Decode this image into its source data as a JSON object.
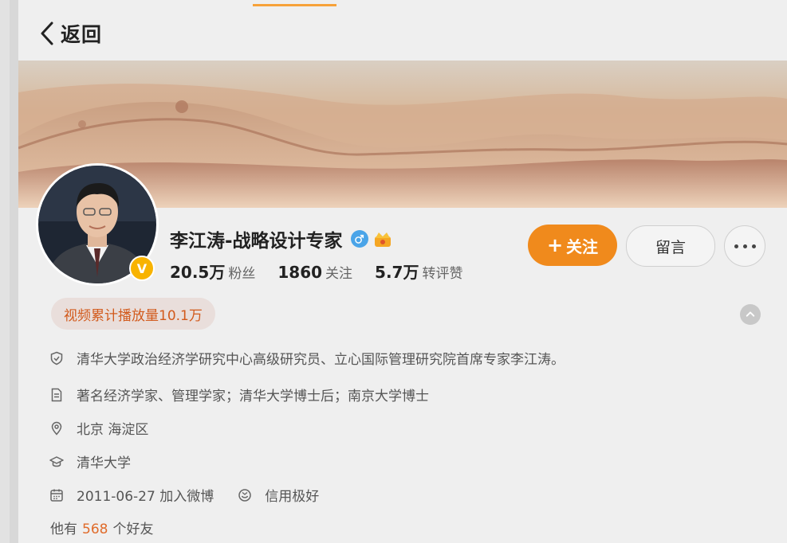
{
  "header": {
    "back_label": "返回"
  },
  "profile": {
    "name": "李江涛-战略设计专家",
    "verified_badge": "V",
    "icons": {
      "gender": "male-icon",
      "crown": "crown-icon"
    },
    "stats": [
      {
        "num": "20.5万",
        "label": "粉丝"
      },
      {
        "num": "1860",
        "label": "关注"
      },
      {
        "num": "5.7万",
        "label": "转评赞"
      }
    ]
  },
  "actions": {
    "follow": "关注",
    "message": "留言"
  },
  "play_tag": "视频累计播放量10.1万",
  "info": {
    "bio": "清华大学政治经济学研究中心高级研究员、立心国际管理研究院首席专家李江涛。",
    "tags": "著名经济学家、管理学家；清华大学博士后；南京大学博士",
    "location": "北京 海淀区",
    "school": "清华大学",
    "joined": "2011-06-27 加入微博",
    "credit": "信用极好",
    "friends_prefix": "他有",
    "friends_count": "568",
    "friends_suffix": "个好友"
  },
  "colors": {
    "accent": "#f08a1c",
    "tag_text": "#d25a1c",
    "tab_indicator": "#f7a23a"
  }
}
